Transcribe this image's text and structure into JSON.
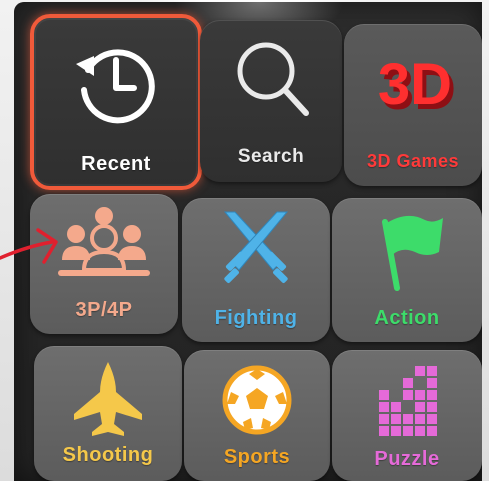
{
  "menu": {
    "tiles": [
      {
        "label": "Recent",
        "icon": "clock-history-icon",
        "color": "#ffffff",
        "selected": true
      },
      {
        "label": "Search",
        "icon": "magnifier-icon",
        "color": "#ffffff",
        "selected": false
      },
      {
        "label": "3D Games",
        "icon": "3d-badge-icon",
        "icon_text": "3D",
        "color": "#ff3a3a",
        "selected": false
      },
      {
        "label": "3P/4P",
        "icon": "multiplayer-icon",
        "color": "#f4a98c",
        "selected": false
      },
      {
        "label": "Fighting",
        "icon": "crossed-swords-icon",
        "color": "#4fb3e8",
        "selected": false
      },
      {
        "label": "Action",
        "icon": "flag-icon",
        "color": "#3ddc6a",
        "selected": false
      },
      {
        "label": "Shooting",
        "icon": "jet-plane-icon",
        "color": "#f5c84a",
        "selected": false
      },
      {
        "label": "Sports",
        "icon": "soccer-ball-icon",
        "color": "#f5a623",
        "selected": false
      },
      {
        "label": "Puzzle",
        "icon": "puzzle-blocks-icon",
        "color": "#e56ad8",
        "selected": false
      }
    ]
  },
  "annotation": {
    "icon": "red-pointer-arrow-icon",
    "color": "#e0202e"
  }
}
